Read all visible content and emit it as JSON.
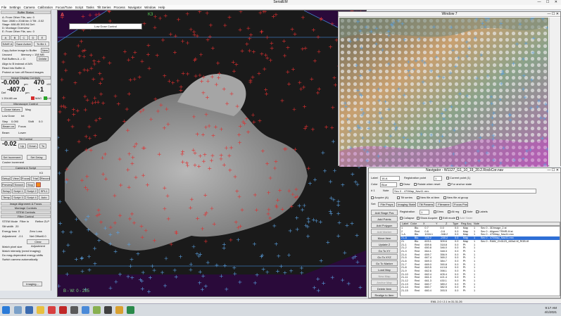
{
  "app": {
    "title": "SerialEM",
    "window_controls": "— ☐ ✕"
  },
  "menu": [
    "File",
    "Settings",
    "Camera",
    "Calibration",
    "Focus/Tune",
    "Script",
    "Tasks",
    "Tilt Series",
    "Process",
    "Navigator",
    "Window",
    "Help"
  ],
  "left_panel": {
    "buffer_status": {
      "header": "Buffer Status",
      "line1": "A: From Other File, sec: 0",
      "line2": "Size: 2880 x 2048  bin 3    Tilt: -0.02",
      "line3": "Stage: 608.85 393.94    Def:",
      "line4": "D: Montage Overview",
      "line5": "E: From Other File, sec: 0"
    },
    "buffer_buttons": {
      "sava_a": "SAVE A",
      "save_active": "Save Active",
      "to_file": "To file 1",
      "buffer_row": [
        "A",
        "B",
        "C",
        "D",
        "E"
      ],
      "new": "New",
      "copy_label": "Copy Active image to Buffer",
      "unused": "Unused",
      "memory": "Memory = 158 MB",
      "roll_buffers": "Roll Buffers A -> D",
      "delete": "Delete",
      "align_to": "Align to B instead of A/N",
      "read_into": "Read into Buffer A",
      "protect": "Protect or turn off Record images"
    },
    "image_display": {
      "header": "Image Display Controls",
      "defocus_value": "-0.000",
      "defocus_unit": "μm",
      "mag_value": "470",
      "mag_unit": "×M",
      "def_label": "Def",
      "def_value": "-407.0",
      "def_unit": "μm",
      "spot": "-1",
      "beam_line": "1 204.88 um",
      "mag_button": "MAG",
      "lm_label": "LM"
    },
    "microscope_control": {
      "header": "Microscope Control",
      "close_valves": "Close Valves",
      "mag_btn": "Mag",
      "low_dose_label": "Low Dose",
      "mode": "Int",
      "step_label": "Step",
      "step_value": "0.090",
      "shift_label": "Shift",
      "shift_value": "0.0",
      "beam_on": "Beam on",
      "focus_btn": "Focus",
      "beam_label": "Beam",
      "level_label": "Lower"
    },
    "tilt_control": {
      "header": "Tilt Control",
      "angle": "-0.02",
      "up": "Up",
      "down": "Down",
      "to": "To",
      "tilt_increment": "Set Increment",
      "set_delay": "Set Delay",
      "cosine_label": "Cosine increment"
    },
    "camera_script": {
      "header": "Camera & Script",
      "camera": "K3",
      "buttons_row1": [
        "Setup",
        "View",
        "Focus",
        "Trial",
        "Record"
      ],
      "buttons_row2": [
        "Preview",
        "Search",
        "Stop",
        "Record"
      ],
      "buttons_row3": [
        "Setup",
        "Script 1",
        "Script 2",
        "SPL1"
      ],
      "buttons_row4": [
        "Temp",
        "Script 3",
        "Script 4",
        "Auto"
      ]
    },
    "lower_headers": [
      "Image Alignment & Focus",
      "Montage Controls",
      "STEM Controls",
      "Filter Control"
    ],
    "filter": {
      "stem_mode": "STEM Mode",
      "filter_in": "Filter in",
      "fill_zlp": "Refine ZLP",
      "slit_width_label": "Slit width",
      "slit_width": "20",
      "energy_loss_label": "Energy loss",
      "energy_loss": "0",
      "zero_loss": "Zero Loss",
      "adjust_label": "Adjustment",
      "adjust_value": "-0.1",
      "net_offset_label": "Net Offset",
      "net_offset": "0.0",
      "clear_adjustment": "Clear Adjustment",
      "match_pixel": "Match pixel size",
      "match_intensity": "Match intensity (need Imaging)",
      "do_mag_dep": "Do mag-dependent energy shifts",
      "auto_camera": "Switch camera automatically"
    },
    "imaging_dropdown": "Imaging..."
  },
  "main_image": {
    "buffer_letter": "A",
    "camera_label": "K3",
    "bw_label": "B - W: 0 - 255",
    "toolbar_text": "Low Dose Control"
  },
  "window7": {
    "title": "Window 7"
  },
  "navigator": {
    "title": "Navigator - W1127_G1_10_19_20.2.RockCor.nav",
    "label_label": "Label",
    "label_value": "16-A",
    "registration_point_label": "Registration point",
    "registration_point": "1",
    "current_point": "Current point (1)",
    "color_label": "Color",
    "color_value": "Blue",
    "draw_label": "Draw",
    "rotate_when_reset": "Rotate when reset",
    "for_anchor_state": "For anchor state",
    "hash_label": "# 1",
    "note_label": "Note",
    "note_value": "Sec 0 - 470Map_Nav11.mrc",
    "acquire": "Acquire (A)",
    "tilt_series": "Tilt series",
    "new_file_at_item": "New file at item",
    "new_file_at_group": "New file at group",
    "set_label": "Set:",
    "file_props": "File Props",
    "imaging_state": "Imaging State",
    "tilt_params": "Tilt Params",
    "filename": "Filename",
    "focus_pos": "Focus Pos",
    "buttons": [
      "Add Stage Pos",
      "Add Points",
      "Add Polygon",
      "Add Marker",
      "Move Item",
      "Update Z",
      "Go To XY",
      "Go To XYZ",
      "Go To Marker",
      "Load Map",
      "New Map",
      "Anchor Map",
      "Delete Item",
      "Realign to Item"
    ],
    "registration_label": "Registration",
    "registration_value": "1",
    "dims_label": "Dims",
    "all_reg": "All reg",
    "note_chk": "Note",
    "labels_chk": "Labels",
    "collapse": "Collapse",
    "show_acquire": "Show Acquire",
    "edit_mode": "Edit mode",
    "add_bsar": "Add Sister",
    "columns": [
      "Label",
      "Color",
      "X",
      "Y",
      "Z",
      "Type",
      "Reg",
      "Acq",
      "Note"
    ],
    "rows": [
      [
        "1",
        "Blu",
        "0.7",
        "0.0",
        "0.0",
        "Map",
        "1",
        "",
        "Sec 0 - 3DImage_2.st"
      ],
      [
        "2",
        "Red",
        "0.8",
        "-0.6",
        "0.0",
        "Map",
        "1",
        "",
        "Sec 0 - Aligned.TRMR.M.st"
      ],
      [
        "1-A",
        "Blu",
        "1016.1",
        "-348.2",
        "0.0",
        "Map",
        "1",
        "",
        "Sec 0 - 470Map_Nav11.mrc"
      ],
      [
        "21-A",
        "Blu",
        "229.2",
        "-240.2",
        "0.0",
        "Map",
        "1",
        "",
        "Sec 0 - 470Map_Nav11.mrc"
      ],
      [
        "21",
        "Blu",
        "603.1",
        "309.6",
        "0.0",
        "Map",
        "1",
        "",
        "Sec 0 - RAW_Ch3123_445s4 tif_RGB.tif"
      ],
      [
        "21-1",
        "Red",
        "659.6",
        "318.8",
        "0.0",
        "Pt",
        "1",
        "",
        ""
      ],
      [
        "21-2",
        "Red",
        "650.8",
        "346.0",
        "0.0",
        "Pt",
        "1",
        "",
        ""
      ],
      [
        "21-3",
        "Red",
        "664.1",
        "348.3",
        "0.0",
        "Pt",
        "1",
        "",
        ""
      ],
      [
        "21-4",
        "Red",
        "659.7",
        "356.9",
        "0.0",
        "Pt",
        "1",
        "",
        ""
      ],
      [
        "21-5",
        "Red",
        "667.4",
        "365.2",
        "0.0",
        "Pt",
        "1",
        "",
        ""
      ],
      [
        "21-6",
        "Red",
        "669.3",
        "384.7",
        "0.0",
        "Pt",
        "1",
        "",
        ""
      ],
      [
        "21-7",
        "Red",
        "669.0",
        "390.8",
        "0.0",
        "Pt",
        "1",
        "",
        ""
      ],
      [
        "21-8",
        "Red",
        "663.5",
        "413.8",
        "0.0",
        "Pt",
        "1",
        "",
        ""
      ],
      [
        "21-9",
        "Red",
        "662.6",
        "398.1",
        "0.0",
        "Pt",
        "1",
        "",
        ""
      ],
      [
        "21-10",
        "Red",
        "662.4",
        "405.4",
        "0.0",
        "Pt",
        "1",
        "",
        ""
      ],
      [
        "21-11",
        "Red",
        "661.0",
        "421.4",
        "0.0",
        "Pt",
        "1",
        "",
        ""
      ],
      [
        "21-12",
        "Red",
        "661.3",
        "430.1",
        "0.0",
        "Pt",
        "1",
        "",
        ""
      ],
      [
        "21-13",
        "Red",
        "660.7",
        "389.2",
        "0.0",
        "Pt",
        "1",
        "",
        ""
      ],
      [
        "21-14",
        "Red",
        "660.7",
        "382.5",
        "0.0",
        "Pt",
        "1",
        "",
        ""
      ],
      [
        "21-15",
        "Red",
        "660.4",
        "393.5",
        "0.0",
        "Pt",
        "1",
        "",
        ""
      ]
    ]
  },
  "status_bar": {
    "text": "EML 2.0 / 2.1  in  31.31.26"
  },
  "taskbar": {
    "time": "9:17 AM",
    "date": "4/1/2021"
  },
  "colors": {
    "image_bg": "#2a0a3a",
    "marker_red": "#e03030",
    "marker_blue": "#5aa0e0",
    "selection": "#2f6fd6"
  }
}
